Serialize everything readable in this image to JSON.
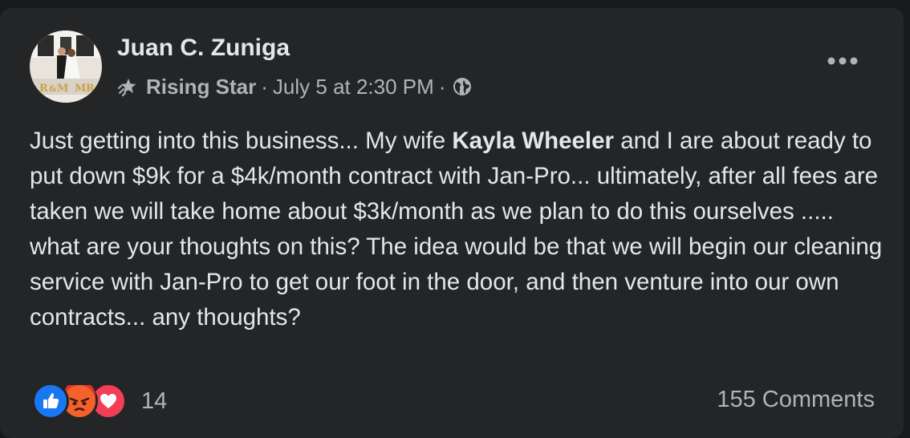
{
  "post": {
    "author": "Juan C. Zuniga",
    "badge": "Rising Star",
    "separator": "·",
    "timestamp": "July 5 at 2:30 PM",
    "privacy_icon": "globe-icon",
    "more_icon": "more-horizontal-icon",
    "text_part1": "Just getting into this business... My wife ",
    "mention": "Kayla Wheeler",
    "text_part2": " and I are about ready to put down $9k for a $4k/month contract with Jan-Pro... ultimately, after all fees are taken we will take home about $3k/month as we plan to do this ourselves ..... what are your thoughts on this? The idea would be that we will begin our cleaning service with Jan-Pro to get our foot in the door, and then venture into our own contracts... any thoughts?"
  },
  "reactions": {
    "icons": [
      "like-icon",
      "angry-icon",
      "love-icon"
    ],
    "count": "14"
  },
  "comments": {
    "label": "155 Comments"
  },
  "colors": {
    "background": "#18191a",
    "card": "#242526",
    "primary_text": "#e4e6eb",
    "secondary_text": "#b0b3b8",
    "like": "#1877f2",
    "angry": "#f5602b",
    "love": "#f33e58"
  }
}
